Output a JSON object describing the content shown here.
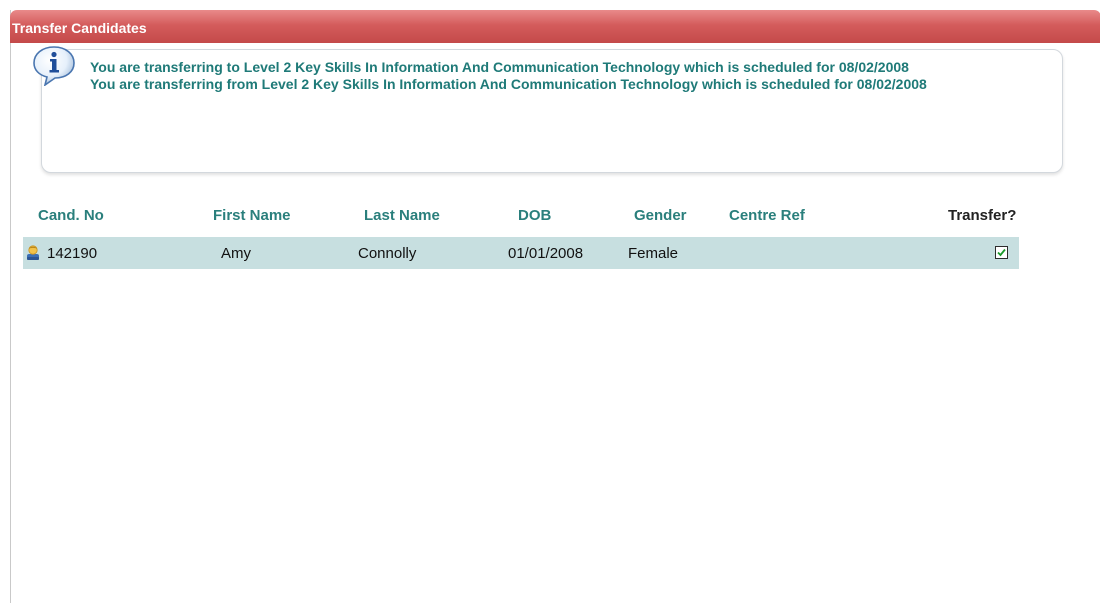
{
  "panel": {
    "title": "Transfer Candidates",
    "header_color": "#d45c5c"
  },
  "info": {
    "icon": "info-speech-bubble-icon",
    "line1": "You are transferring to Level 2 Key Skills In Information And Communication Technology which is scheduled for 08/02/2008",
    "line2": "You are transferring from Level 2 Key Skills In Information And Communication Technology which is scheduled for 08/02/2008",
    "text_color": "#1f7a78"
  },
  "table": {
    "columns": [
      "Cand. No",
      "First Name",
      "Last Name",
      "DOB",
      "Gender",
      "Centre Ref",
      "Transfer?"
    ],
    "rows": [
      {
        "icon": "person-icon",
        "cand_no": "142190",
        "first_name": "Amy",
        "last_name": "Connolly",
        "dob": "01/01/2008",
        "gender": "Female",
        "centre_ref": "",
        "transfer": true
      }
    ],
    "row_color": "#c7dfe0"
  }
}
